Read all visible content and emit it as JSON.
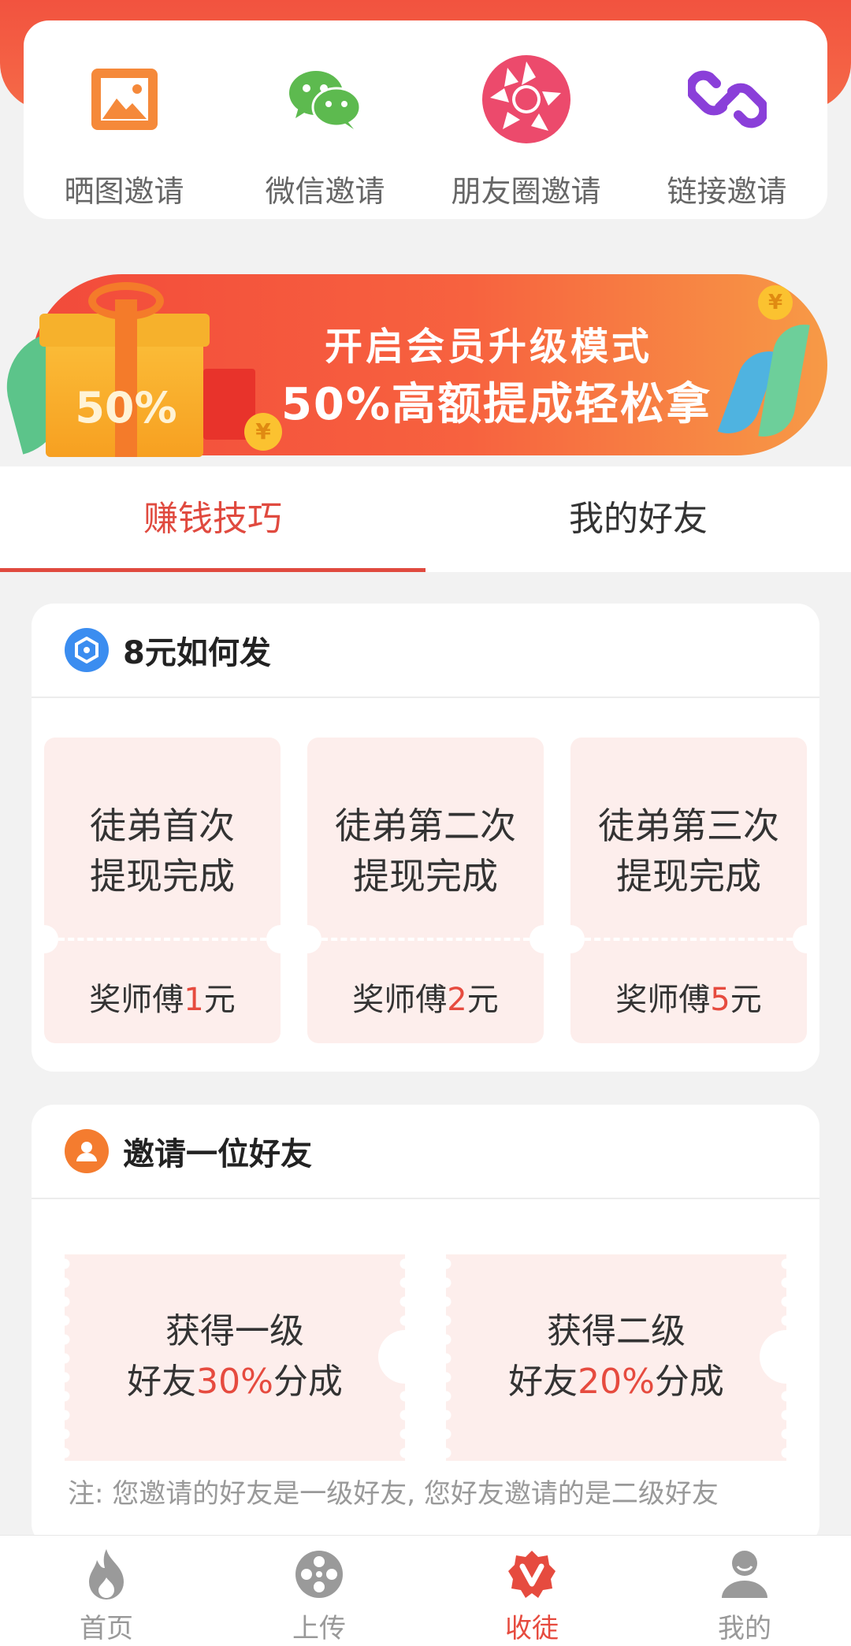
{
  "share": {
    "items": [
      {
        "label": "晒图邀请",
        "icon": "image-icon"
      },
      {
        "label": "微信邀请",
        "icon": "wechat-icon"
      },
      {
        "label": "朋友圈邀请",
        "icon": "moments-icon"
      },
      {
        "label": "链接邀请",
        "icon": "link-icon"
      }
    ]
  },
  "banner": {
    "title": "开启会员升级模式",
    "subtitle": "50%高额提成轻松拿",
    "gift_percent": "50%",
    "coin_symbol": "¥"
  },
  "tabs": [
    {
      "label": "赚钱技巧",
      "active": true
    },
    {
      "label": "我的好友",
      "active": false
    }
  ],
  "earn_card": {
    "title": "8元如何发",
    "icon": "hexagon-icon",
    "tickets": [
      {
        "line1": "徒弟首次",
        "line2": "提现完成",
        "reward_prefix": "奖师傅",
        "reward_amount": "1",
        "reward_suffix": "元"
      },
      {
        "line1": "徒弟第二次",
        "line2": "提现完成",
        "reward_prefix": "奖师傅",
        "reward_amount": "2",
        "reward_suffix": "元"
      },
      {
        "line1": "徒弟第三次",
        "line2": "提现完成",
        "reward_prefix": "奖师傅",
        "reward_amount": "5",
        "reward_suffix": "元"
      }
    ]
  },
  "invite_card": {
    "title": "邀请一位好友",
    "icon": "user-icon",
    "coupons": [
      {
        "line1": "获得一级",
        "line2_prefix": "好友",
        "percent": "30%",
        "line2_suffix": "分成"
      },
      {
        "line1": "获得二级",
        "line2_prefix": "好友",
        "percent": "20%",
        "line2_suffix": "分成"
      }
    ],
    "note": "注: 您邀请的好友是一级好友, 您好友邀请的是二级好友"
  },
  "navbar": {
    "items": [
      {
        "label": "首页",
        "icon": "flame-icon",
        "active": false
      },
      {
        "label": "上传",
        "icon": "film-reel-icon",
        "active": false
      },
      {
        "label": "收徒",
        "icon": "v-badge-icon",
        "active": true
      },
      {
        "label": "我的",
        "icon": "person-icon",
        "active": false
      }
    ]
  },
  "colors": {
    "accent": "#e64b3f",
    "ticket_bg": "#fdeeec",
    "page_bg": "#f2f2f2"
  }
}
